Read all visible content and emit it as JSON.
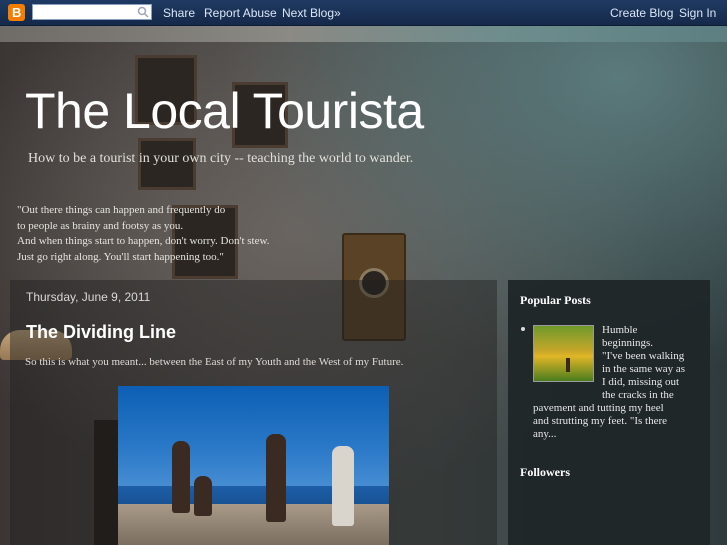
{
  "navbar": {
    "logo_letter": "B",
    "share": "Share",
    "report_abuse": "Report Abuse",
    "next_blog": "Next Blog»",
    "create_blog": "Create Blog",
    "sign_in": "Sign In",
    "search_placeholder": ""
  },
  "header": {
    "title": "The Local Tourista",
    "description": "How to be a tourist in your own city -- teaching the world to wander.",
    "quote_lines": [
      "\"Out there things can happen and frequently do",
      "to people as brainy and footsy as you.",
      "And when things start to happen, don't worry. Don't stew.",
      "Just go right along. You'll start happening too.\""
    ]
  },
  "post": {
    "date": "Thursday, June 9, 2011",
    "title": "The Dividing Line",
    "body": "So this is what you meant... between the East of my Youth and the West of my Future."
  },
  "sidebar": {
    "popular_heading": "Popular Posts",
    "popular_lines_right": [
      "Humble",
      "beginnings.",
      "\"I've been walking",
      "in the same way as",
      "I did, missing out",
      "the cracks in the"
    ],
    "popular_lines_full": [
      "pavement and tutting my heel",
      "and strutting my feet. \"Is there",
      "any..."
    ],
    "followers_heading": "Followers"
  },
  "colors": {
    "navbar": "#1f3a63",
    "blogger_orange": "#f57d00",
    "title_text": "#ffffff"
  }
}
